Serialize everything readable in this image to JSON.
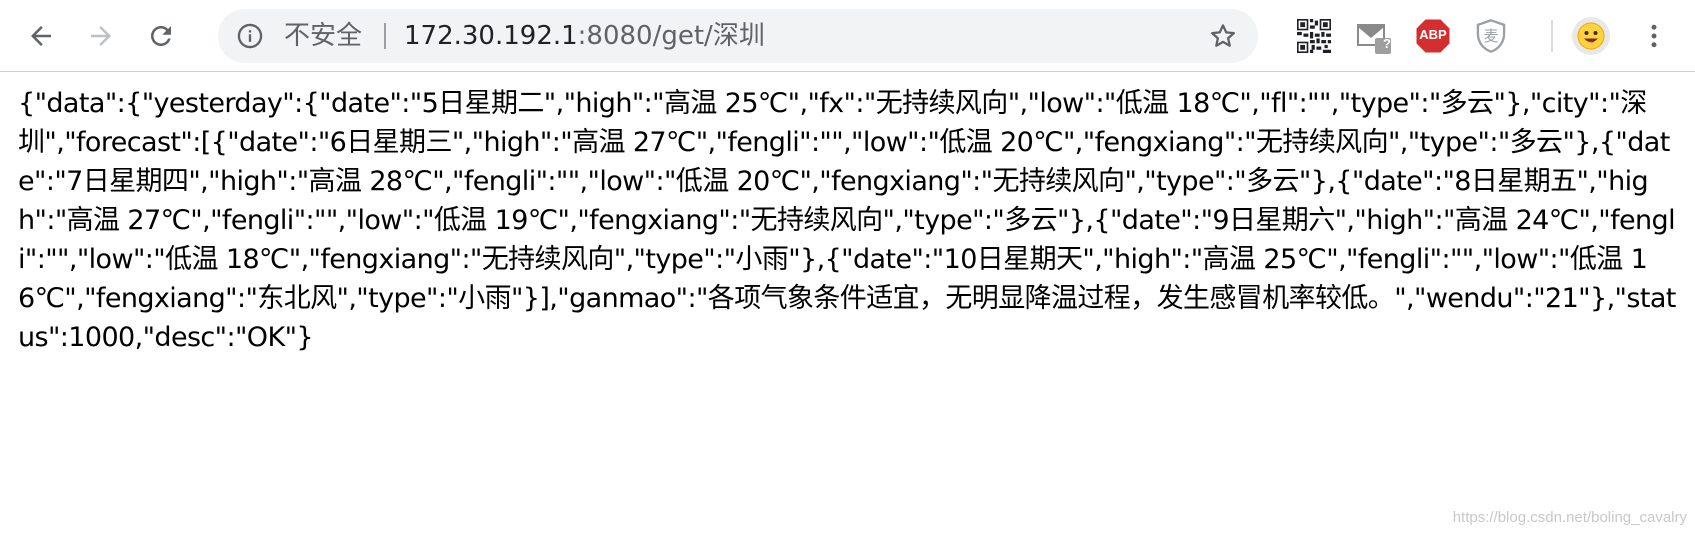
{
  "address_bar": {
    "security_label": "不安全",
    "url_host": "172.30.192.1",
    "url_rest": ":8080/get/深圳"
  },
  "toolbar": {
    "icons": [
      "back-icon",
      "forward-icon",
      "reload-icon",
      "info-icon",
      "star-icon",
      "qr-code-icon",
      "gmail-icon",
      "adblock-plus-icon",
      "shield-extension-icon",
      "avatar",
      "menu-icon"
    ],
    "gmail_badge": "?",
    "abp_label": "ABP",
    "shield_label": "麦"
  },
  "content": {
    "json_text": "{\"data\":{\"yesterday\":{\"date\":\"5日星期二\",\"high\":\"高温 25℃\",\"fx\":\"无持续风向\",\"low\":\"低温 18℃\",\"fl\":\"\",\"type\":\"多云\"},\"city\":\"深圳\",\"forecast\":[{\"date\":\"6日星期三\",\"high\":\"高温 27℃\",\"fengli\":\"\",\"low\":\"低温 20℃\",\"fengxiang\":\"无持续风向\",\"type\":\"多云\"},{\"date\":\"7日星期四\",\"high\":\"高温 28℃\",\"fengli\":\"\",\"low\":\"低温 20℃\",\"fengxiang\":\"无持续风向\",\"type\":\"多云\"},{\"date\":\"8日星期五\",\"high\":\"高温 27℃\",\"fengli\":\"\",\"low\":\"低温 19℃\",\"fengxiang\":\"无持续风向\",\"type\":\"多云\"},{\"date\":\"9日星期六\",\"high\":\"高温 24℃\",\"fengli\":\"\",\"low\":\"低温 18℃\",\"fengxiang\":\"无持续风向\",\"type\":\"小雨\"},{\"date\":\"10日星期天\",\"high\":\"高温 25℃\",\"fengli\":\"\",\"low\":\"低温 16℃\",\"fengxiang\":\"东北风\",\"type\":\"小雨\"}],\"ganmao\":\"各项气象条件适宜，无明显降温过程，发生感冒机率较低。\",\"wendu\":\"21\"},\"status\":1000,\"desc\":\"OK\"}"
  },
  "watermark": "https://blog.csdn.net/boling_cavalry",
  "colors": {
    "toolbar_bg": "#ffffff",
    "omnibox_bg": "#f1f3f4",
    "icon_gray": "#5f6368",
    "abp_red": "#d32f2f"
  }
}
